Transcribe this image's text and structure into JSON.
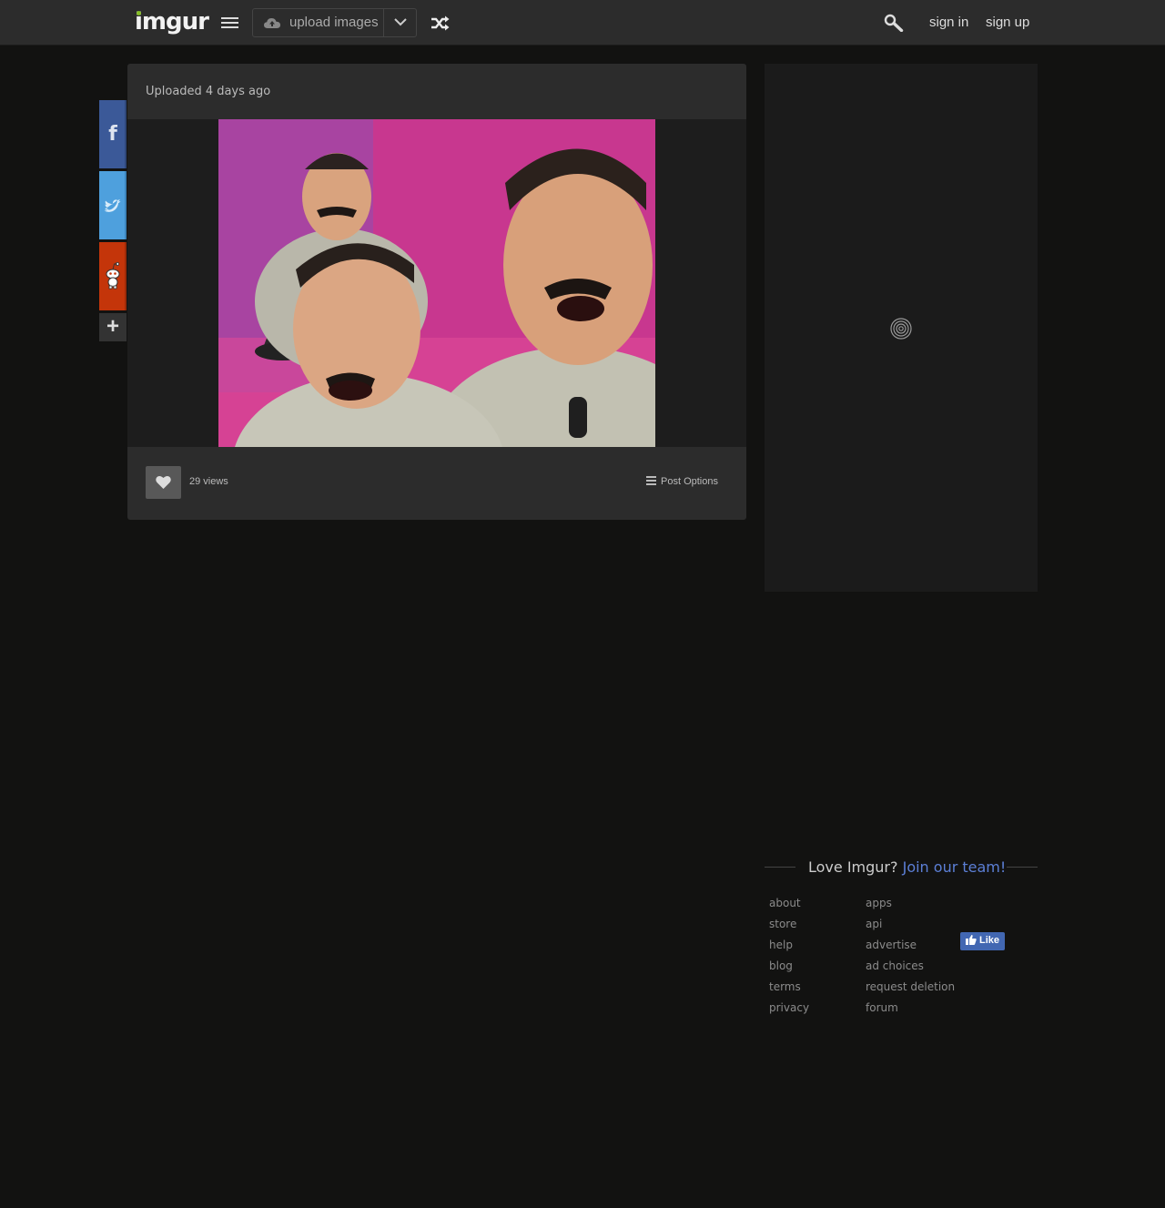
{
  "topbar": {
    "logo": "imgur",
    "upload_label": "upload images",
    "sign_in": "sign in",
    "sign_up": "sign up",
    "icons": [
      "menu-icon",
      "cloud-upload-icon",
      "chevron-down-icon",
      "shuffle-icon",
      "search-icon"
    ]
  },
  "share": {
    "facebook_glyph": "f",
    "more_glyph": "+",
    "colors": {
      "facebook": "#3b5998",
      "twitter": "#4ea0dd",
      "reddit": "#c4350a"
    }
  },
  "post": {
    "uploaded_label": "Uploaded",
    "uploaded_ago": "4 days ago",
    "views": "29 views",
    "post_options": "Post Options"
  },
  "footer": {
    "love": "Love Imgur?",
    "join": "Join our team!",
    "col1": [
      "about",
      "store",
      "help",
      "blog",
      "terms",
      "privacy"
    ],
    "col2": [
      "apps",
      "api",
      "advertise",
      "ad choices",
      "request deletion",
      "forum"
    ],
    "fb_like": "Like"
  },
  "colors": {
    "accent": "#85bf25",
    "link": "#5c7fd6",
    "background": "#121211",
    "panel": "#2c2c2c"
  }
}
